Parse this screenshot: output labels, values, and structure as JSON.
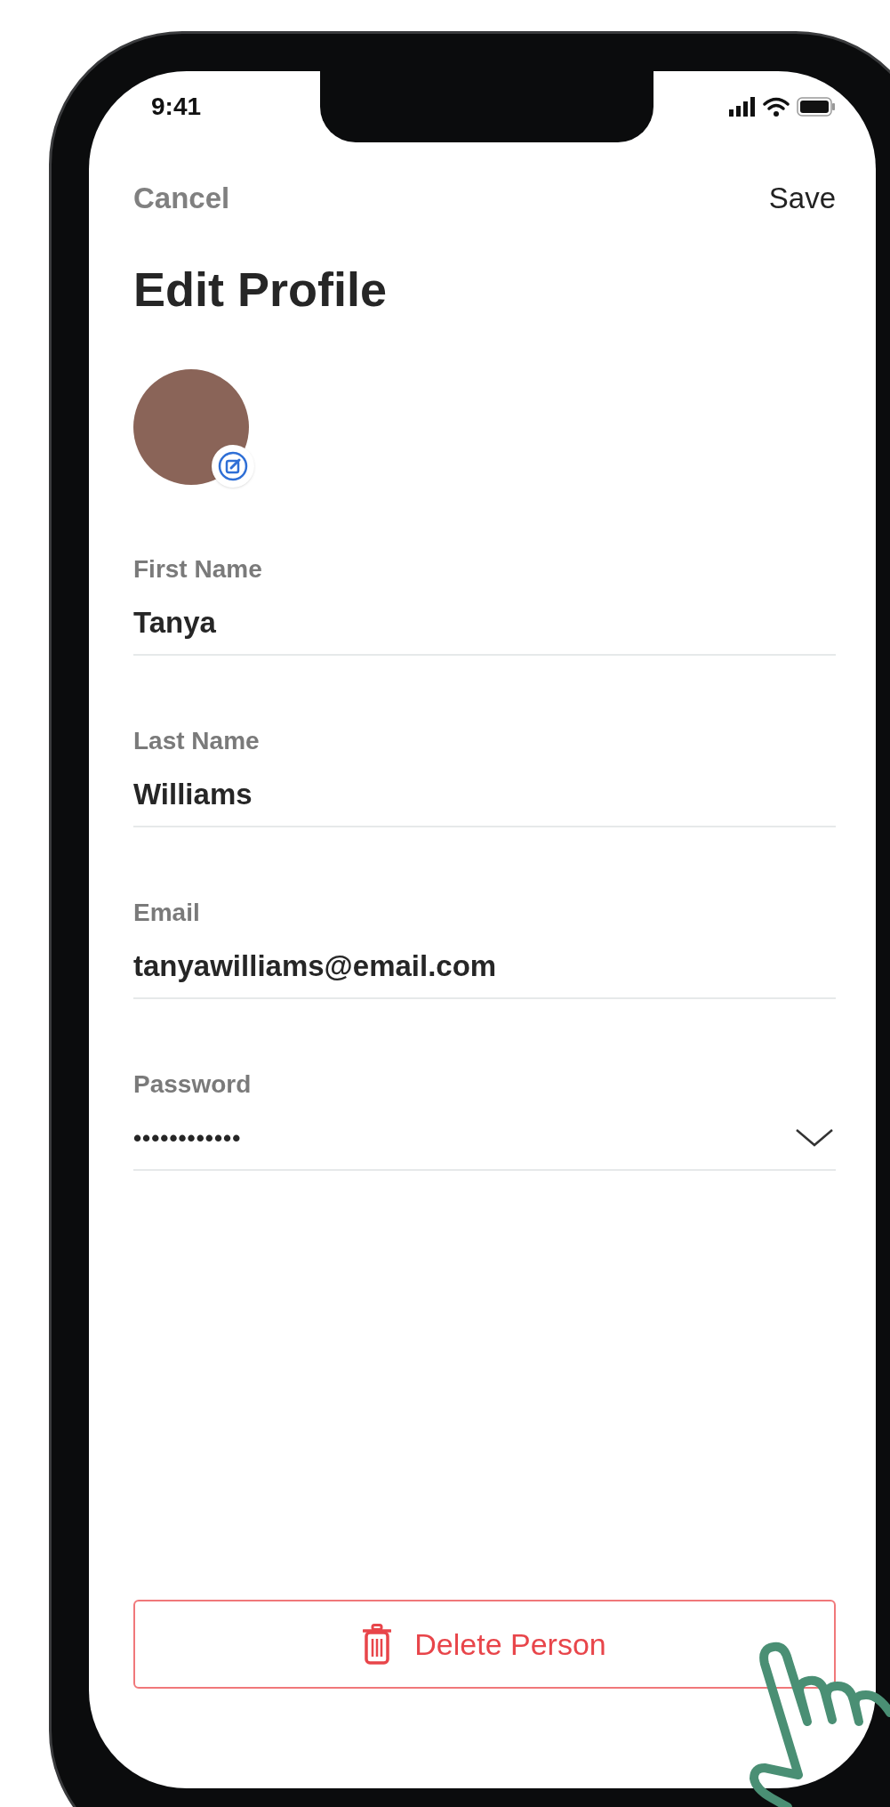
{
  "status_bar": {
    "time": "9:41"
  },
  "nav": {
    "cancel": "Cancel",
    "save": "Save"
  },
  "title": "Edit Profile",
  "fields": [
    {
      "kind": "text",
      "label": "First Name",
      "value": "Tanya"
    },
    {
      "kind": "text",
      "label": "Last Name",
      "value": "Williams"
    },
    {
      "kind": "text",
      "label": "Email",
      "value": "tanyawilliams@email.com"
    },
    {
      "kind": "password",
      "label": "Password",
      "value": "••••••••••••"
    }
  ],
  "delete_button": {
    "label": "Delete Person"
  }
}
